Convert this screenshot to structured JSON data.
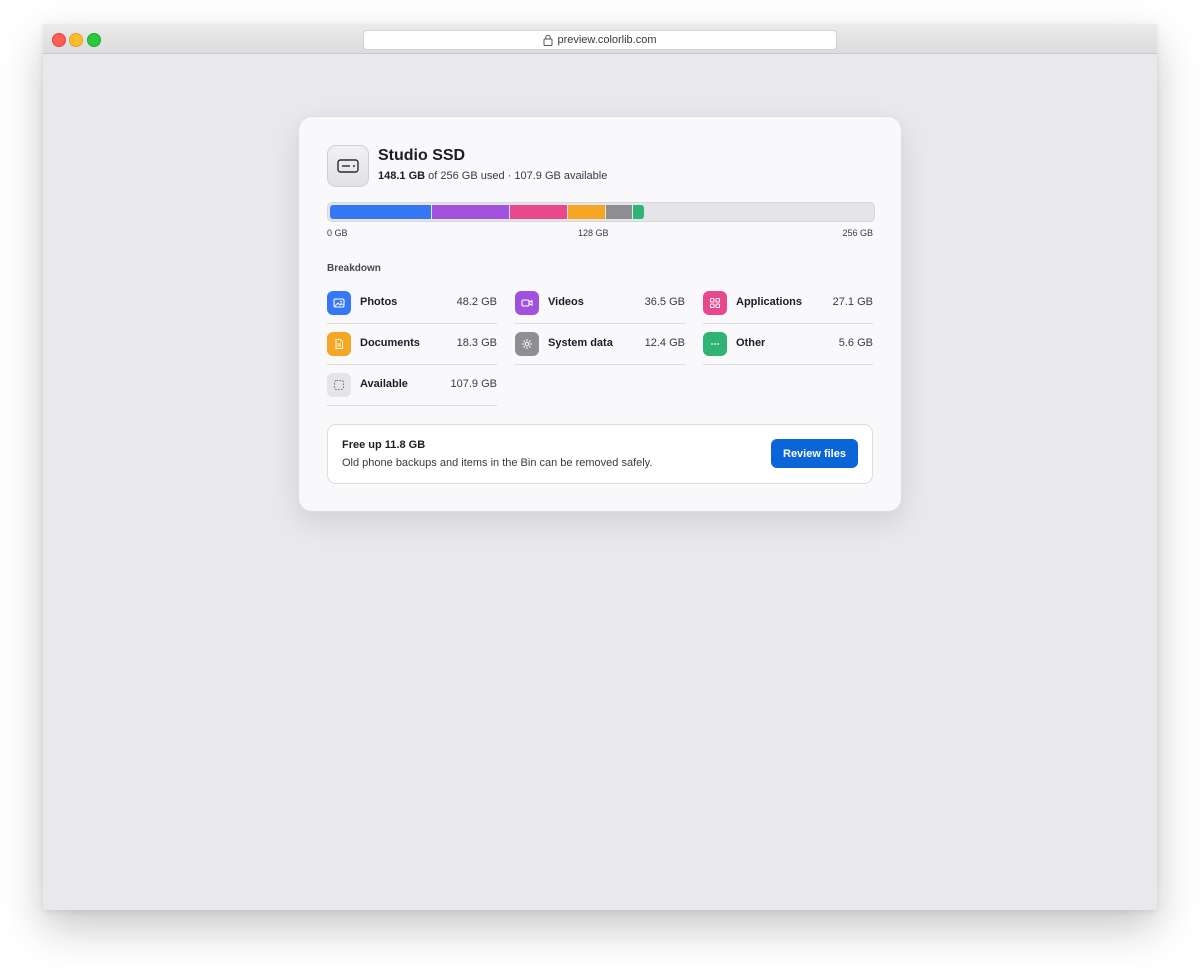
{
  "browser": {
    "url": "preview.colorlib.com"
  },
  "drive": {
    "name": "Studio SSD",
    "used": "148.1 GB",
    "used_suffix": "of 256 GB used · 107.9 GB available",
    "icon": "drive-icon"
  },
  "usage_bar": {
    "total_gb": 256,
    "segments": [
      {
        "name": "Photos",
        "gb": 48.2,
        "color": "#3478f6"
      },
      {
        "name": "Videos",
        "gb": 36.5,
        "color": "#a052dc"
      },
      {
        "name": "Applications",
        "gb": 27.1,
        "color": "#e8488c"
      },
      {
        "name": "Documents",
        "gb": 18.3,
        "color": "#f5a623"
      },
      {
        "name": "System data",
        "gb": 12.4,
        "color": "#8e8e93"
      },
      {
        "name": "Other",
        "gb": 5.6,
        "color": "#2fb476"
      }
    ],
    "axis": [
      "0 GB",
      "128 GB",
      "256 GB"
    ]
  },
  "breakdown": {
    "label": "Breakdown",
    "items": [
      {
        "name": "Photos",
        "value": "48.2 GB",
        "icon": "photo-icon",
        "color": "#3478f6"
      },
      {
        "name": "Videos",
        "value": "36.5 GB",
        "icon": "video-icon",
        "color": "#a052dc"
      },
      {
        "name": "Applications",
        "value": "27.1 GB",
        "icon": "grid-icon",
        "color": "#e8488c"
      },
      {
        "name": "Documents",
        "value": "18.3 GB",
        "icon": "document-icon",
        "color": "#f5a623"
      },
      {
        "name": "System data",
        "value": "12.4 GB",
        "icon": "gear-icon",
        "color": "#8e8e93"
      },
      {
        "name": "Other",
        "value": "5.6 GB",
        "icon": "ellipsis-icon",
        "color": "#2fb476"
      },
      {
        "name": "Available",
        "value": "107.9 GB",
        "icon": "dashed-square-icon",
        "color": "#e4e4e9"
      }
    ]
  },
  "tip": {
    "title": "Free up 11.8 GB",
    "text": "Old phone backups and items in the Bin can be removed safely.",
    "button": "Review files",
    "button_color": "#0a66d8"
  }
}
